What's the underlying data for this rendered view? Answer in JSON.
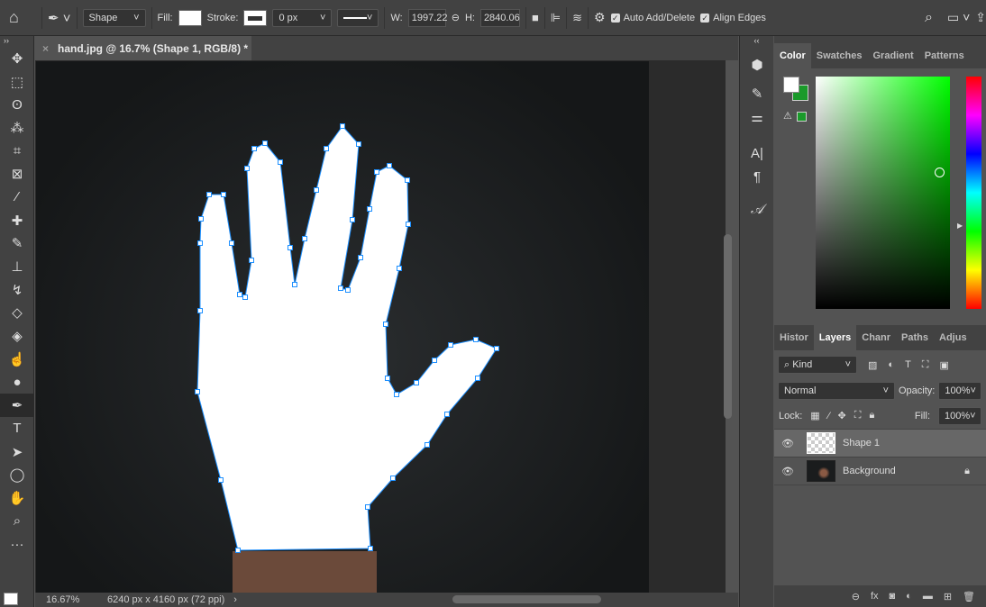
{
  "options_bar": {
    "mode": "Shape",
    "fill_label": "Fill:",
    "stroke_label": "Stroke:",
    "stroke_width": "0 px",
    "w_label": "W:",
    "w_value": "1997.22",
    "h_label": "H:",
    "h_value": "2840.06",
    "auto_add_delete": "Auto Add/Delete",
    "align_edges": "Align Edges",
    "fill_color": "#ffffff"
  },
  "document": {
    "tab_title": "hand.jpg @ 16.7% (Shape 1, RGB/8) *",
    "zoom": "16.67%",
    "info": "6240 px x 4160 px (72 ppi)"
  },
  "color_panel": {
    "tabs": [
      "Color",
      "Swatches",
      "Gradient",
      "Patterns"
    ],
    "active": "Color",
    "foreground": "#ffffff",
    "background": "#1a9a2a",
    "hue_color": "#00ff00"
  },
  "layers_panel": {
    "tabs": [
      "Histor",
      "Layers",
      "Chanr",
      "Paths",
      "Adjus"
    ],
    "active": "Layers",
    "filter": "Kind",
    "blend_mode": "Normal",
    "opacity_label": "Opacity:",
    "opacity": "100%",
    "lock_label": "Lock:",
    "fill_label": "Fill:",
    "fill": "100%",
    "layers": [
      {
        "name": "Shape 1",
        "selected": true
      },
      {
        "name": "Background",
        "locked": true
      }
    ]
  },
  "tools": [
    "move",
    "marquee",
    "lasso",
    "magic-wand",
    "crop",
    "frame",
    "eyedropper",
    "healing",
    "brush",
    "stamp",
    "history-brush",
    "eraser",
    "paint-bucket",
    "smudge",
    "dodge",
    "pen",
    "type",
    "path-select",
    "ellipse",
    "hand",
    "zoom",
    "more"
  ]
}
